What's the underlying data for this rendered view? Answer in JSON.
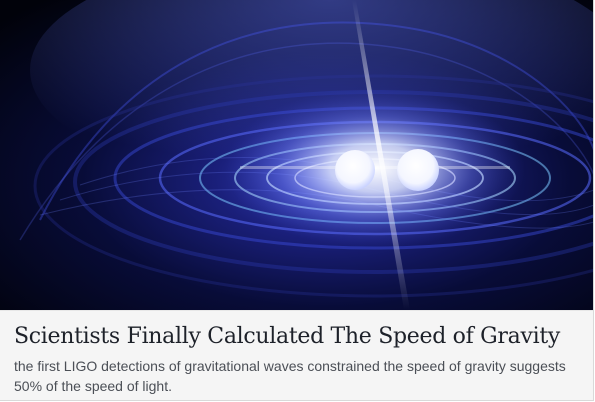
{
  "post": {
    "title": "Scientists Finally Calculated The Speed of Gravity",
    "description": "the first LIGO detections of gravitational waves constrained the speed of gravity suggests 50% of the speed of light."
  },
  "image": {
    "subject": "merging-stars-gravitational-waves-illustration",
    "colors": {
      "background": "#02030f",
      "wave": "#5a6cff",
      "glow": "#dfe6ff"
    }
  }
}
